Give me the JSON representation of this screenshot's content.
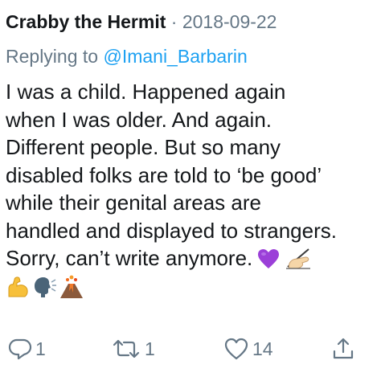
{
  "tweet": {
    "author": "Crabby the Hermit",
    "separator": "·",
    "date": "2018-09-22",
    "replying_prefix": "Replying to",
    "mention": "@Imani_Barbarin",
    "lines": [
      "I was a child.  Happened again",
      "when I was older.  And again.",
      "Different people.  But so many",
      "disabled folks are told to ‘be good’",
      "while their genital areas are",
      "handled and displayed to strangers.",
      "Sorry, can’t write anymore."
    ],
    "emojis": [
      "purple-heart",
      "writing-hand",
      "flexed-biceps",
      "speaking-head",
      "volcano"
    ]
  },
  "actions": {
    "reply_count": "1",
    "retweet_count": "1",
    "like_count": "14"
  },
  "colors": {
    "text": "#14171a",
    "muted": "#657786",
    "link": "#1da1f2",
    "heart": "#9b3fd8"
  }
}
